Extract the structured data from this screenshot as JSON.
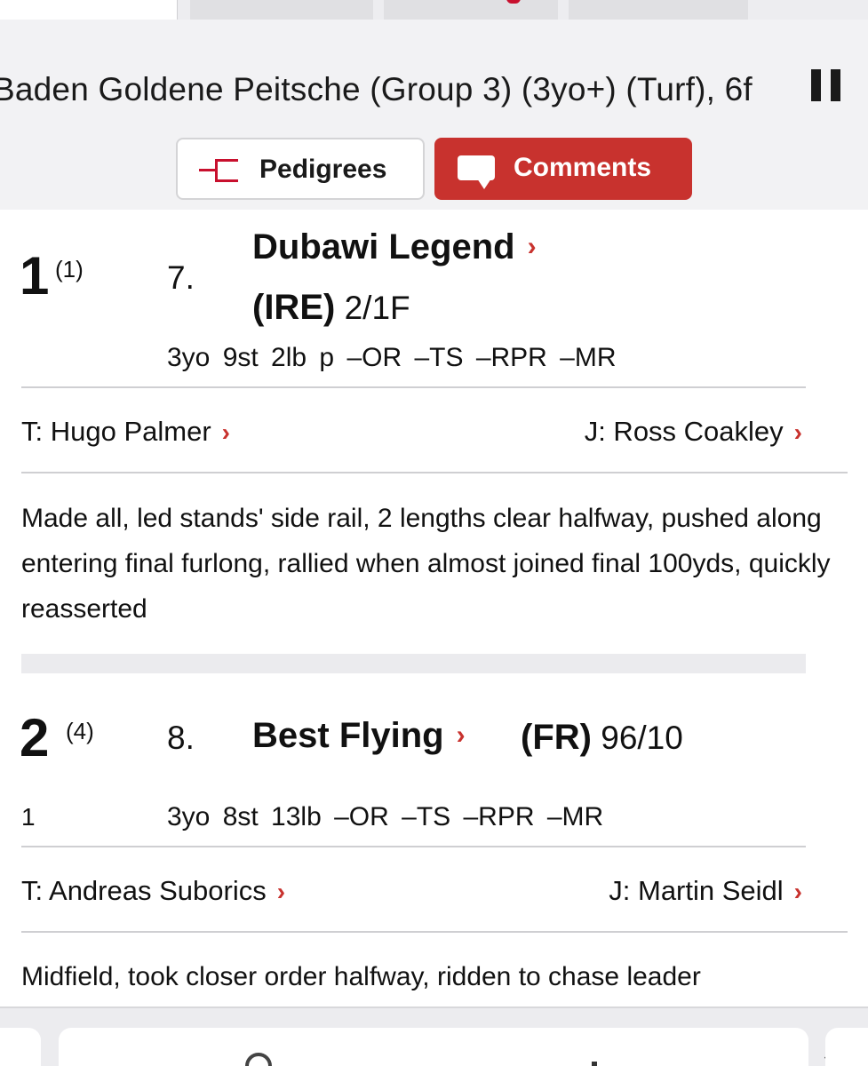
{
  "header": {
    "race_title": "Baden Goldene Peitsche (Group 3) (3yo+) (Turf), 6f",
    "pedigrees_label": "Pedigrees",
    "comments_label": "Comments"
  },
  "runners": [
    {
      "position": "1",
      "draw": "(1)",
      "cloth": "7.",
      "name": "Dubawi Legend",
      "country": "(IRE)",
      "odds": "2/1F",
      "lengths": "",
      "stats": "3yo  9st  2lb p  –OR  –TS  –RPR  –MR",
      "trainer": "T: Hugo Palmer",
      "jockey": "J: Ross Coakley",
      "comment": "Made all, led stands' side rail, 2 lengths clear halfway, pushed along entering final furlong, rallied when almost joined final 100yds, quickly reasserted"
    },
    {
      "position": "2",
      "draw": "(4)",
      "cloth": "8.",
      "name": "Best Flying",
      "country": "(FR)",
      "odds": "96/10",
      "lengths": "1",
      "stats": "3yo  8st  13lb  –OR  –TS  –RPR  –MR",
      "trainer": "T: Andreas Suborics",
      "jockey": "J: Martin Seidl",
      "comment": "Midfield, took closer order halfway, ridden to chase leader"
    }
  ],
  "colors": {
    "accent": "#c8322e",
    "header_bg": "#f2f2f4"
  },
  "icons": [
    "pause-icon",
    "pedigree-icon",
    "comment-icon",
    "chevron-right-icon"
  ]
}
